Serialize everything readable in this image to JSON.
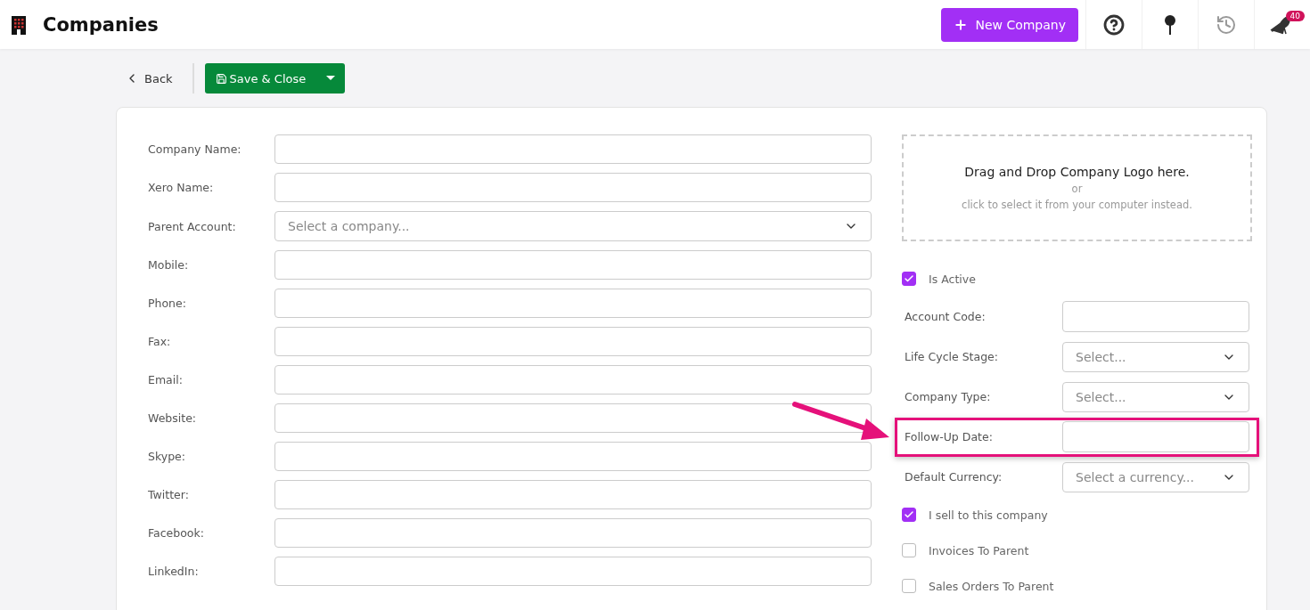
{
  "header": {
    "title": "Companies",
    "new_button": "New Company",
    "notification_count": "40"
  },
  "toolbar": {
    "back": "Back",
    "save": "Save & Close"
  },
  "left_fields": [
    {
      "label": "Company Name:",
      "kind": "text"
    },
    {
      "label": "Xero Name:",
      "kind": "text"
    },
    {
      "label": "Parent Account:",
      "kind": "select",
      "placeholder": "Select a company..."
    },
    {
      "label": "Mobile:",
      "kind": "text"
    },
    {
      "label": "Phone:",
      "kind": "text"
    },
    {
      "label": "Fax:",
      "kind": "text"
    },
    {
      "label": "Email:",
      "kind": "text"
    },
    {
      "label": "Website:",
      "kind": "text"
    },
    {
      "label": "Skype:",
      "kind": "text"
    },
    {
      "label": "Twitter:",
      "kind": "text"
    },
    {
      "label": "Facebook:",
      "kind": "text"
    },
    {
      "label": "LinkedIn:",
      "kind": "text"
    }
  ],
  "dropzone": {
    "title": "Drag and Drop Company Logo here.",
    "separator": "or",
    "hint": "click to select it from your computer instead."
  },
  "right_items": [
    {
      "kind": "checkbox",
      "label": "Is Active",
      "checked": true
    },
    {
      "kind": "text",
      "label": "Account Code:",
      "highlighted": false
    },
    {
      "kind": "select",
      "label": "Life Cycle Stage:",
      "placeholder": "Select...",
      "highlighted": false
    },
    {
      "kind": "select",
      "label": "Company Type:",
      "placeholder": "Select...",
      "highlighted": false
    },
    {
      "kind": "text",
      "label": "Follow-Up Date:",
      "highlighted": true
    },
    {
      "kind": "select",
      "label": "Default Currency:",
      "placeholder": "Select a currency...",
      "highlighted": false
    },
    {
      "kind": "checkbox",
      "label": "I sell to this company",
      "checked": true
    },
    {
      "kind": "checkbox",
      "label": "Invoices To Parent",
      "checked": false
    },
    {
      "kind": "checkbox",
      "label": "Sales Orders To Parent",
      "checked": false
    }
  ]
}
